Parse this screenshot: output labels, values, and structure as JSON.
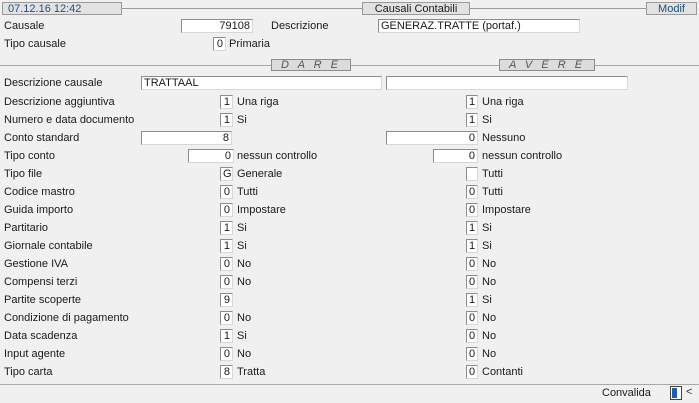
{
  "window": {
    "datetime": "07.12.16 12:42",
    "title": "Causali Contabili",
    "mode": "Modif"
  },
  "header": {
    "causale_label": "Causale",
    "causale_value": "79108",
    "descrizione_label": "Descrizione",
    "descrizione_value": "GENERAZ.TRATTE  (portaf.)",
    "tipo_causale_label": "Tipo causale",
    "tipo_causale_value": "0",
    "tipo_causale_desc": "Primaria"
  },
  "sections": {
    "dare": "D A R E",
    "avere": "A V E R E"
  },
  "descrizione_causale": {
    "label": "Descrizione causale",
    "dare": "TRATTAAL",
    "avere": ""
  },
  "rows": [
    {
      "label": "Descrizione aggiuntiva",
      "dare_value": "1",
      "dare_desc": "Una riga",
      "avere_value": "1",
      "avere_desc": "Una riga"
    },
    {
      "label": "Numero e data documento",
      "dare_value": "1",
      "dare_desc": "Si",
      "avere_value": "1",
      "avere_desc": "Si"
    },
    {
      "label": "Conto standard",
      "dare_value": "8",
      "dare_desc": "",
      "avere_value": "0",
      "avere_desc": "Nessuno"
    },
    {
      "label": "Tipo conto",
      "dare_value": "0",
      "dare_desc": "nessun controllo",
      "avere_value": "0",
      "avere_desc": "nessun controllo"
    },
    {
      "label": "Tipo file",
      "dare_value": "G",
      "dare_desc": "Generale",
      "avere_value": "",
      "avere_desc": "Tutti"
    },
    {
      "label": "Codice mastro",
      "dare_value": "0",
      "dare_desc": "Tutti",
      "avere_value": "0",
      "avere_desc": "Tutti"
    },
    {
      "label": "Guida importo",
      "dare_value": "0",
      "dare_desc": "Impostare",
      "avere_value": "0",
      "avere_desc": "Impostare"
    },
    {
      "label": "Partitario",
      "dare_value": "1",
      "dare_desc": "Si",
      "avere_value": "1",
      "avere_desc": "Si"
    },
    {
      "label": "Giornale contabile",
      "dare_value": "1",
      "dare_desc": "Si",
      "avere_value": "1",
      "avere_desc": "Si"
    },
    {
      "label": "Gestione IVA",
      "dare_value": "0",
      "dare_desc": "No",
      "avere_value": "0",
      "avere_desc": "No"
    },
    {
      "label": "Compensi terzi",
      "dare_value": "0",
      "dare_desc": "No",
      "avere_value": "0",
      "avere_desc": "No"
    },
    {
      "label": "Partite scoperte",
      "dare_value": "9",
      "dare_desc": "",
      "avere_value": "1",
      "avere_desc": "Si"
    },
    {
      "label": "Condizione di pagamento",
      "dare_value": "0",
      "dare_desc": "No",
      "avere_value": "0",
      "avere_desc": "No"
    },
    {
      "label": "Data scadenza",
      "dare_value": "1",
      "dare_desc": "Si",
      "avere_value": "0",
      "avere_desc": "No"
    },
    {
      "label": "Input agente",
      "dare_value": "0",
      "dare_desc": "No",
      "avere_value": "0",
      "avere_desc": "No"
    },
    {
      "label": "Tipo carta",
      "dare_value": "8",
      "dare_desc": "Tratta",
      "avere_value": "0",
      "avere_desc": "Contanti"
    }
  ],
  "footer": {
    "convalida_label": "Convalida",
    "arrow": "<"
  }
}
